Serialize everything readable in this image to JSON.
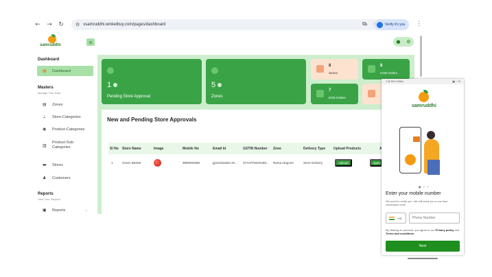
{
  "browser": {
    "url": "vsamruddhi.winketbuy.com/pages/dashboard",
    "verify_label": "Verify it's you"
  },
  "app": {
    "brand": "samruddhi"
  },
  "sidebar": {
    "dashboard_title": "Dashboard",
    "dashboard_item": "Dashboard",
    "masters_title": "Masters",
    "masters_sub": "Manage Your Data",
    "masters_items": [
      "Zones",
      "Store-Categories",
      "Product-Categories",
      "Product-Sub-\nCategories",
      "Stores",
      "Customers"
    ],
    "reports_title": "Reports",
    "reports_sub": "View Your Reports",
    "reports_item": "Reports"
  },
  "stats": {
    "pending": {
      "value": "1",
      "label": "Pending Store Approval"
    },
    "zones": {
      "value": "5",
      "label": "Zones"
    },
    "stores": {
      "value": "8",
      "label": "Stores"
    },
    "cod": {
      "value": "8",
      "label": "COD Orders"
    },
    "eod": {
      "value": "7",
      "label": "EOD Orders"
    }
  },
  "approvals": {
    "title": "New and Pending Store Approvals",
    "columns": [
      "Sl No",
      "Store Name",
      "Image",
      "Mobile No",
      "Email Id",
      "GSTIN Number",
      "Zone",
      "Delivery Type",
      "Upload Products",
      "A"
    ],
    "rows": [
      {
        "sl": "1",
        "store": "Green Basket",
        "mobile": "9885592588",
        "email": "jgreenbasket 25...",
        "gstin": "37AAFFM2034M...",
        "zone": "Rama rangorts",
        "delivery": "Store Delivery",
        "upload_label": "Upload",
        "approve_label": "Approve"
      }
    ]
  },
  "phone": {
    "status_time": "7:00 PM 0.3KB/s",
    "status_signal": "▮▮ ◔ 79",
    "brand": "samruddhi",
    "title": "Enter your mobile number",
    "subtitle": "We need to verify you. We will send you a one time verification code.",
    "country_code": "+91",
    "phone_placeholder": "Phone Number",
    "terms_prefix": "By clicking on proceed, you agree to our",
    "privacy_label": "Privacy policy",
    "terms_and": "and",
    "terms_label": "Terms and conditions",
    "next_label": "Next"
  },
  "colors": {
    "primary_green": "#3aa346",
    "light_green": "#cdeecd",
    "accent_orange": "#f39c12"
  }
}
